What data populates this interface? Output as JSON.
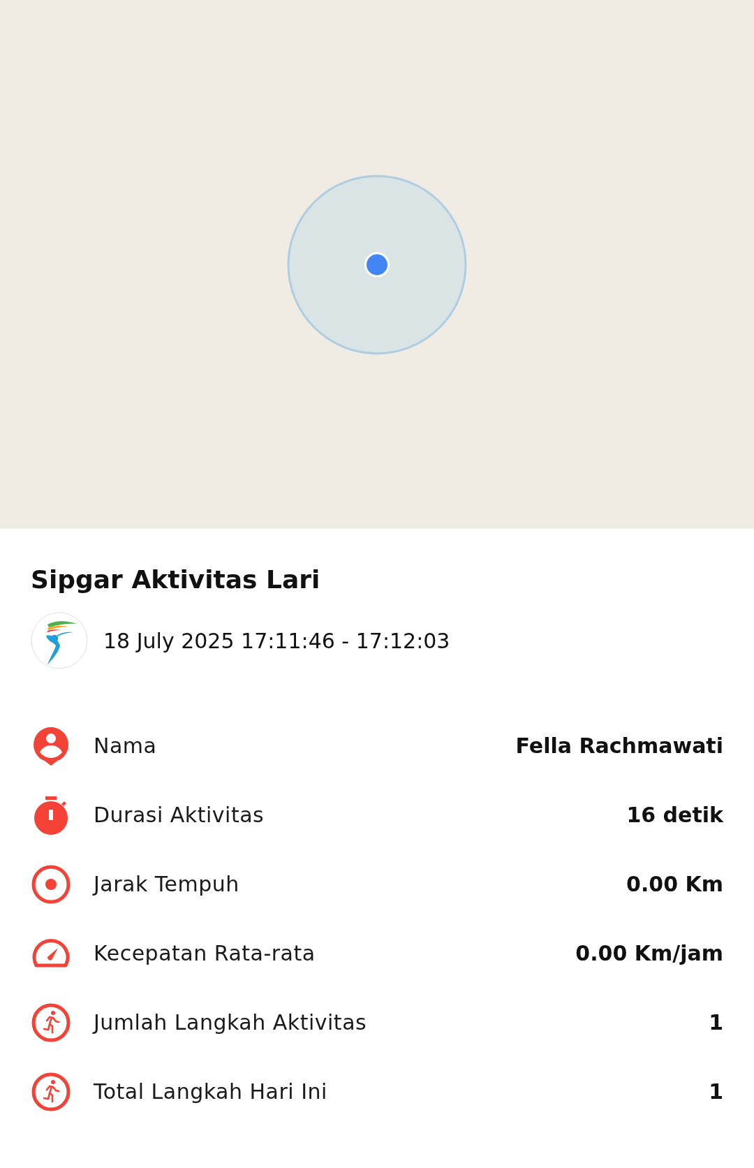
{
  "title": "Sipgar Aktivitas Lari",
  "date_range": "18 July 2025 17:11:46 - 17:12:03",
  "stats": [
    {
      "kind": "person",
      "label": "Nama",
      "value": "Fella Rachmawati"
    },
    {
      "kind": "timer",
      "label": "Durasi Aktivitas",
      "value": "16 detik"
    },
    {
      "kind": "target",
      "label": "Jarak Tempuh",
      "value": "0.00 Km"
    },
    {
      "kind": "speed",
      "label": "Kecepatan Rata-rata",
      "value": "0.00 Km/jam"
    },
    {
      "kind": "run",
      "label": "Jumlah Langkah Aktivitas",
      "value": "1"
    },
    {
      "kind": "run",
      "label": "Total Langkah Hari Ini",
      "value": "1"
    }
  ]
}
